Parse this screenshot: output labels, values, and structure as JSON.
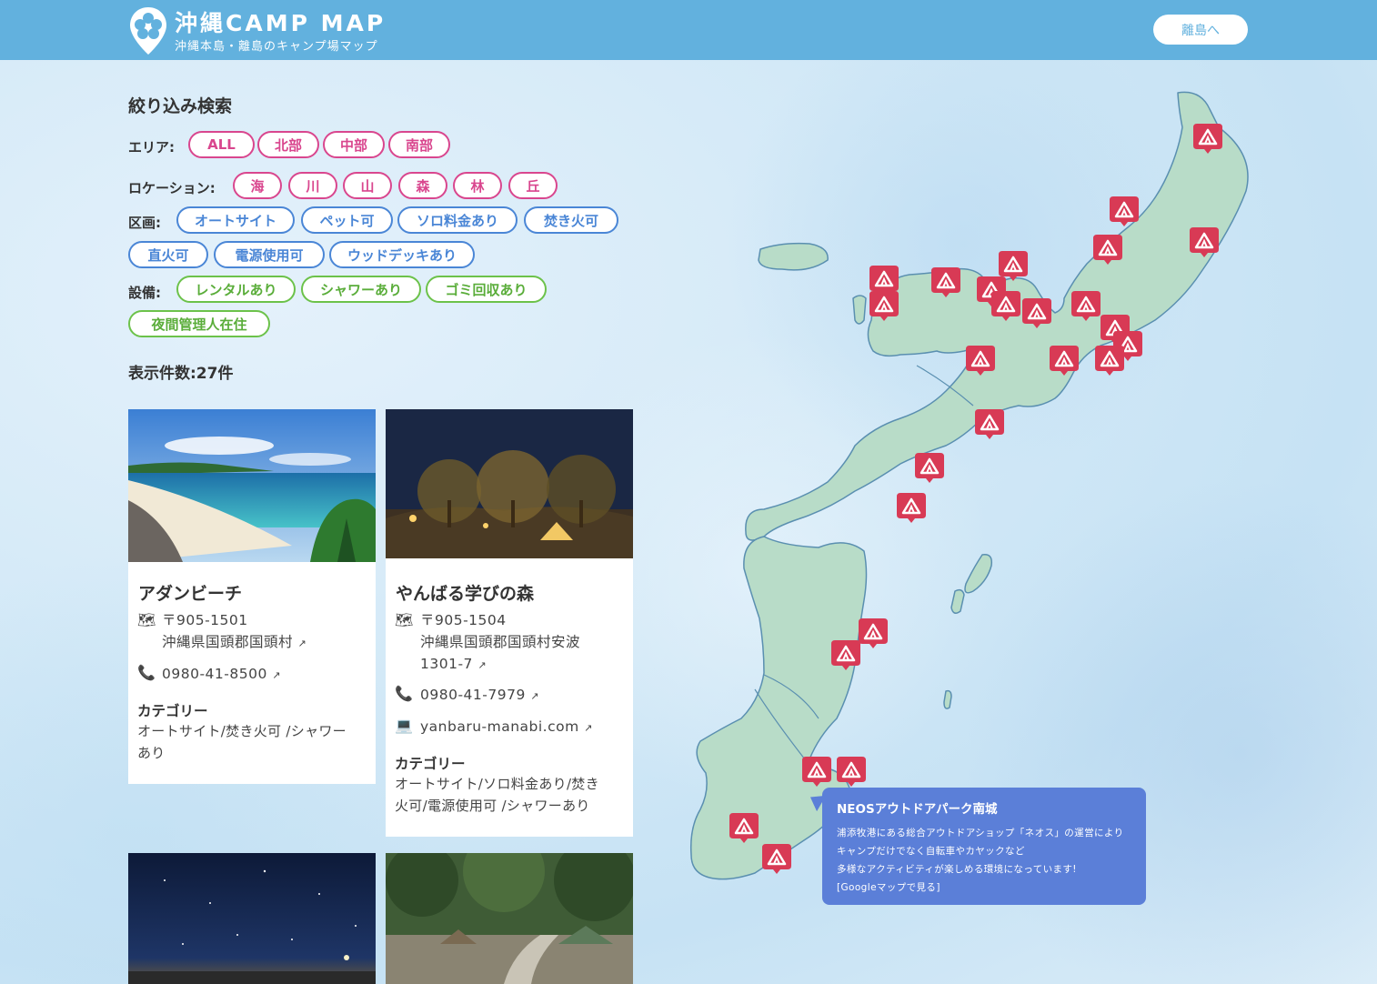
{
  "header": {
    "title": "沖縄CAMP MAP",
    "subtitle": "沖縄本島・離島のキャンプ場マップ",
    "island_button": "離島へ"
  },
  "filter": {
    "title": "絞り込み検索",
    "area_label": "エリア:",
    "area": [
      "ALL",
      "北部",
      "中部",
      "南部"
    ],
    "location_label": "ロケーション:",
    "location": [
      "海",
      "川",
      "山",
      "森",
      "林",
      "丘"
    ],
    "section_label": "区画:",
    "section": [
      "オートサイト",
      "ペット可",
      "ソロ料金あり",
      "焚き火可",
      "直火可",
      "電源使用可",
      "ウッドデッキあり"
    ],
    "facility_label": "設備:",
    "facility": [
      "レンタルあり",
      "シャワーあり",
      "ゴミ回収あり",
      "夜間管理人在住"
    ],
    "count": "表示件数:27件"
  },
  "cards": [
    {
      "name": "アダンビーチ",
      "postal": "〒905-1501",
      "address": "沖縄県国頭郡国頭村",
      "phone": "0980-41-8500",
      "category_label": "カテゴリー",
      "category_line1": "オートサイト/焚き火可 /シャワー",
      "category_line2": "あり"
    },
    {
      "name": "やんばる学びの森",
      "postal": "〒905-1504",
      "address_line1": "沖縄県国頭郡国頭村安波",
      "address_line2": "1301-7",
      "phone": "0980-41-7979",
      "url": "yanbaru-manabi.com",
      "category_label": "カテゴリー",
      "category_line1": "オートサイト/ソロ料金あり/焚き",
      "category_line2": "火可/電源使用可 /シャワーあり"
    }
  ],
  "popup": {
    "title": "NEOSアウトドアパーク南城",
    "line1": "浦添牧港にある総合アウトドアショップ「ネオス」の運営により",
    "line2": "キャンプだけでなく自転車やカヤックなど",
    "line3": "多様なアクティビティが楽しめる環境になっています!",
    "link": "[Googleマップで見る]"
  },
  "icons": {
    "map": "map-icon",
    "phone": "phone-icon",
    "web": "laptop-icon",
    "external": "external-link-icon",
    "marker": "tent-marker-icon",
    "logo": "hibiscus-pin-icon"
  },
  "colors": {
    "header": "#62b1de",
    "pink": "#d9468e",
    "blue": "#4a86d6",
    "green": "#6cc24a",
    "marker": "#d83a55",
    "land": "#b8dcc8",
    "popup": "#5b7fd8"
  }
}
